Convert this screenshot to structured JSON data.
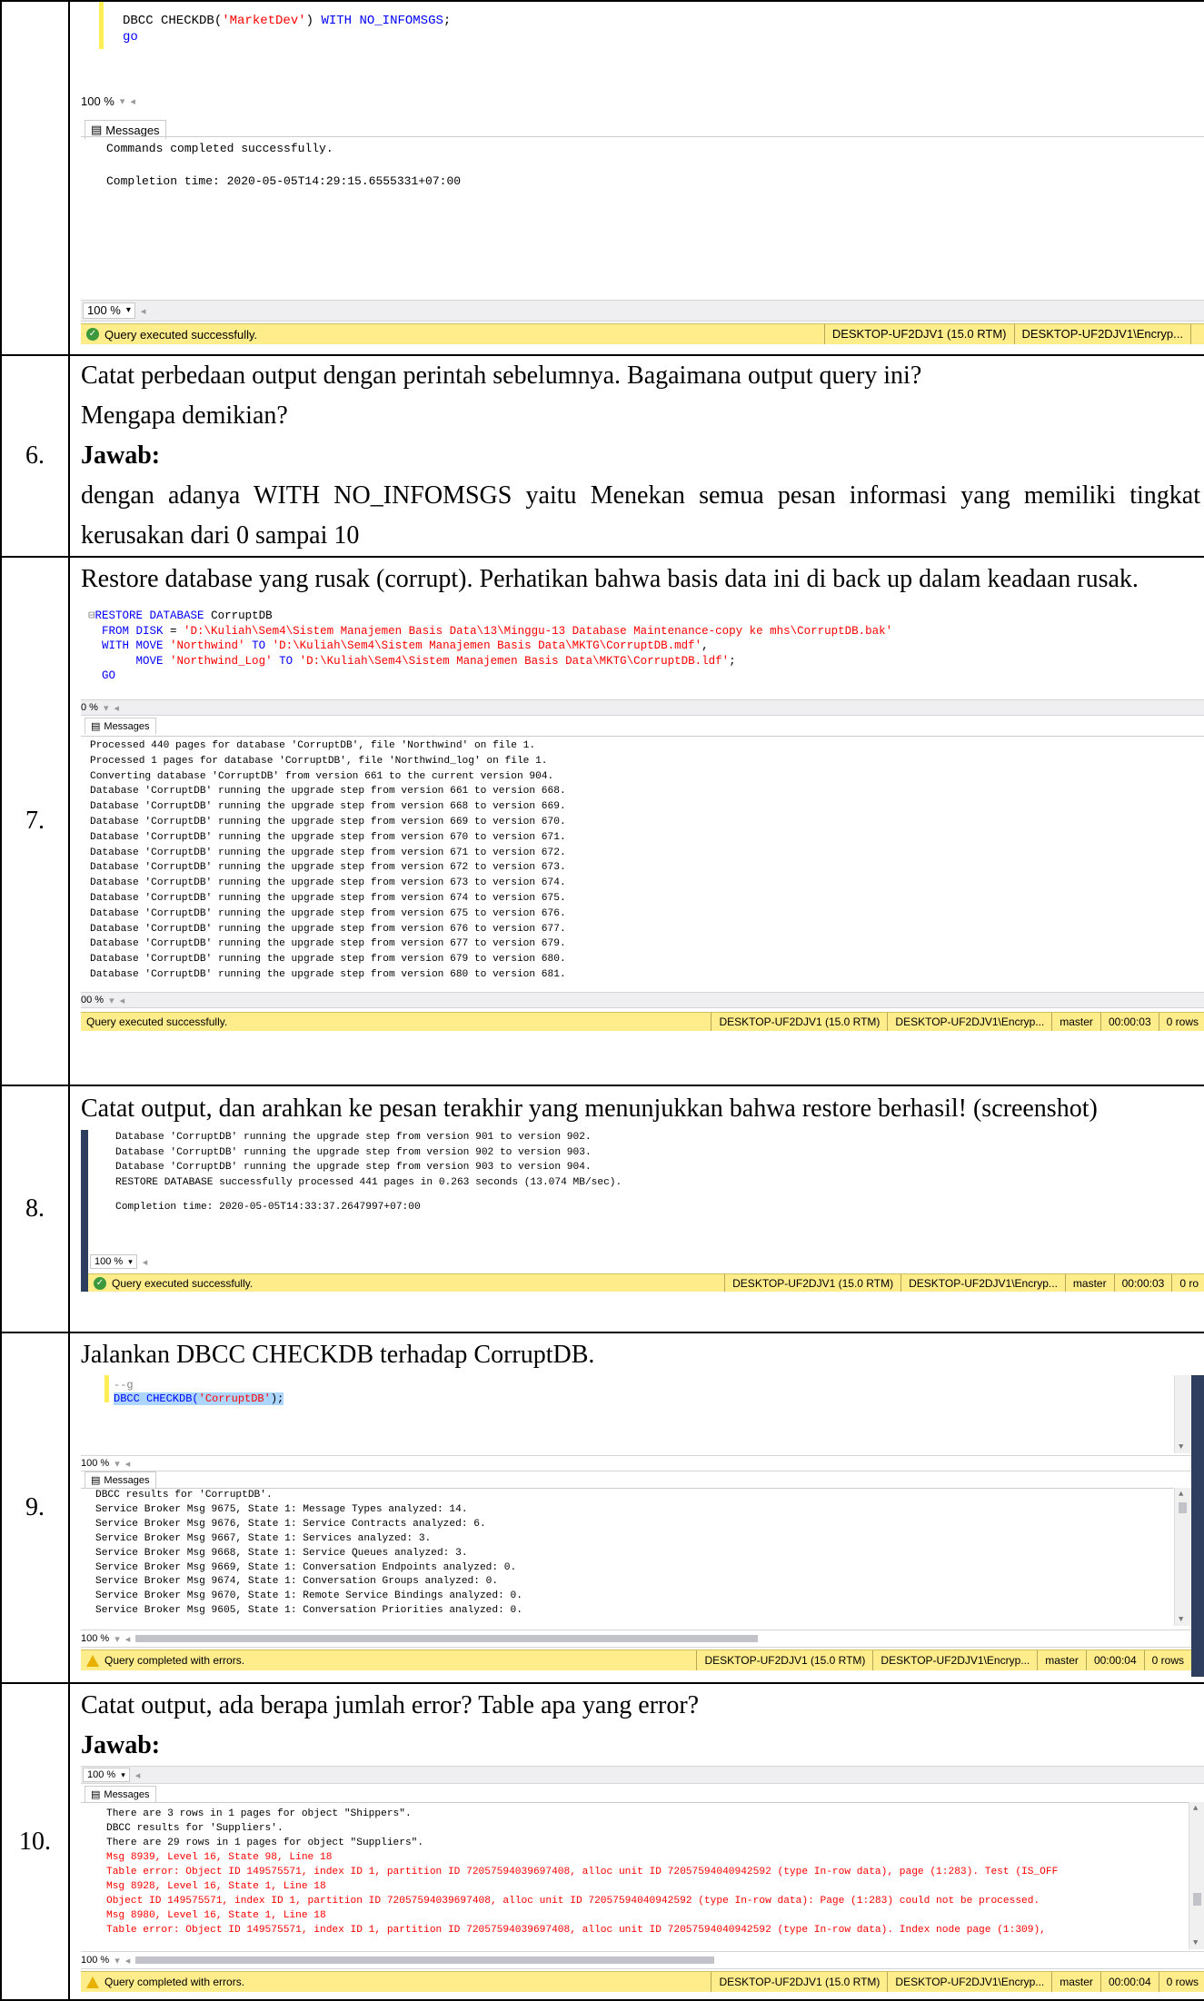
{
  "rows": [
    {
      "number": "",
      "shot1": {
        "code_line1_pre": "DBCC CHECKDB(",
        "code_line1_str": "'MarketDev'",
        "code_line1_mid": ") ",
        "code_line1_kw": "WITH NO_INFOMSGS",
        "code_line1_end": ";",
        "code_line2": "go",
        "zoom": "100 %",
        "messages_tab": "Messages",
        "messages": [
          "Commands completed successfully.",
          "",
          "Completion time: 2020-05-05T14:29:15.6555331+07:00"
        ],
        "status": "Query executed successfully.",
        "server": "DESKTOP-UF2DJV1 (15.0 RTM)",
        "user": "DESKTOP-UF2DJV1\\Encryp..."
      }
    },
    {
      "number": "6.",
      "text1": "Catat perbedaan output dengan perintah sebelumnya. Bagaimana output query ini?",
      "text2": "Mengapa demikian?",
      "answer_label": "Jawab:",
      "answer": "dengan adanya WITH NO_INFOMSGS yaitu Menekan semua pesan informasi yang memiliki tingkat kerusakan dari 0 sampai 10"
    },
    {
      "number": "7.",
      "text": "Restore database yang rusak (corrupt). Perhatikan bahwa basis data ini di back up dalam keadaan rusak.",
      "shot": {
        "l1_kw": "RESTORE DATABASE",
        "l1_rest": " CorruptDB",
        "l2_kw": "FROM DISK",
        "l2_eq": " = ",
        "l2_str": "'D:\\Kuliah\\Sem4\\Sistem Manajemen Basis Data\\13\\Minggu-13 Database Maintenance-copy ke mhs\\CorruptDB.bak'",
        "l3_kw": "WITH MOVE",
        "l3_s1": "'Northwind'",
        "l3_to": " TO ",
        "l3_s2": "'D:\\Kuliah\\Sem4\\Sistem Manajemen Basis Data\\MKTG\\CorruptDB.mdf'",
        "l3_end": ",",
        "l4_kw": "MOVE",
        "l4_s1": "'Northwind_Log'",
        "l4_to": " TO ",
        "l4_s2": "'D:\\Kuliah\\Sem4\\Sistem Manajemen Basis Data\\MKTG\\CorruptDB.ldf'",
        "l4_end": ";",
        "l5": "GO",
        "zoom_top": "0 %",
        "messages_tab": "Messages",
        "messages": [
          "Processed 440 pages for database 'CorruptDB', file 'Northwind' on file 1.",
          "Processed 1 pages for database 'CorruptDB', file 'Northwind_log' on file 1.",
          "Converting database 'CorruptDB' from version 661 to the current version 904.",
          "Database 'CorruptDB' running the upgrade step from version 661 to version 668.",
          "Database 'CorruptDB' running the upgrade step from version 668 to version 669.",
          "Database 'CorruptDB' running the upgrade step from version 669 to version 670.",
          "Database 'CorruptDB' running the upgrade step from version 670 to version 671.",
          "Database 'CorruptDB' running the upgrade step from version 671 to version 672.",
          "Database 'CorruptDB' running the upgrade step from version 672 to version 673.",
          "Database 'CorruptDB' running the upgrade step from version 673 to version 674.",
          "Database 'CorruptDB' running the upgrade step from version 674 to version 675.",
          "Database 'CorruptDB' running the upgrade step from version 675 to version 676.",
          "Database 'CorruptDB' running the upgrade step from version 676 to version 677.",
          "Database 'CorruptDB' running the upgrade step from version 677 to version 679.",
          "Database 'CorruptDB' running the upgrade step from version 679 to version 680.",
          "Database 'CorruptDB' running the upgrade step from version 680 to version 681."
        ],
        "zoom_bottom": "00 %",
        "status": "Query executed successfully.",
        "server": "DESKTOP-UF2DJV1 (15.0 RTM)",
        "user": "DESKTOP-UF2DJV1\\Encryp...",
        "db": "master",
        "time": "00:00:03",
        "rows": "0 rows"
      }
    },
    {
      "number": "8.",
      "text": "Catat output, dan arahkan ke pesan terakhir yang menunjukkan bahwa restore berhasil! (screenshot)",
      "shot": {
        "messages": [
          "Database 'CorruptDB' running the upgrade step from version 901 to version 902.",
          "Database 'CorruptDB' running the upgrade step from version 902 to version 903.",
          "Database 'CorruptDB' running the upgrade step from version 903 to version 904.",
          "RESTORE DATABASE successfully processed 441 pages in 0.263 seconds (13.074 MB/sec).",
          "",
          "Completion time: 2020-05-05T14:33:37.2647997+07:00"
        ],
        "zoom": "100 %",
        "status": "Query executed successfully.",
        "server": "DESKTOP-UF2DJV1 (15.0 RTM)",
        "user": "DESKTOP-UF2DJV1\\Encryp...",
        "db": "master",
        "time": "00:00:03",
        "rows": "0 ro"
      }
    },
    {
      "number": "9.",
      "text": "Jalankan DBCC CHECKDB terhadap CorruptDB.",
      "shot": {
        "code_pre": "DBCC CHECKDB(",
        "code_str": "'CorruptDB'",
        "code_end": ");",
        "zoom": "100 %",
        "messages_tab": "Messages",
        "messages": [
          "DBCC results for 'CorruptDB'.",
          "Service Broker Msg 9675, State 1: Message Types analyzed: 14.",
          "Service Broker Msg 9676, State 1: Service Contracts analyzed: 6.",
          "Service Broker Msg 9667, State 1: Services analyzed: 3.",
          "Service Broker Msg 9668, State 1: Service Queues analyzed: 3.",
          "Service Broker Msg 9669, State 1: Conversation Endpoints analyzed: 0.",
          "Service Broker Msg 9674, State 1: Conversation Groups analyzed: 0.",
          "Service Broker Msg 9670, State 1: Remote Service Bindings analyzed: 0.",
          "Service Broker Msg 9605, State 1: Conversation Priorities analyzed: 0."
        ],
        "zoom_bottom": "100 %",
        "status": "Query completed with errors.",
        "server": "DESKTOP-UF2DJV1 (15.0 RTM)",
        "user": "DESKTOP-UF2DJV1\\Encryp...",
        "db": "master",
        "time": "00:00:04",
        "rows": "0 rows"
      }
    },
    {
      "number": "10.",
      "text": "Catat output, ada berapa jumlah error? Table apa yang error?",
      "answer_label": "Jawab:",
      "shot": {
        "zoom_top": "100 %",
        "messages_tab": "Messages",
        "messages": [
          {
            "t": "There are 3 rows in 1 pages for object \"Shippers\".",
            "red": false
          },
          {
            "t": "DBCC results for 'Suppliers'.",
            "red": false
          },
          {
            "t": "There are 29 rows in 1 pages for object \"Suppliers\".",
            "red": false
          },
          {
            "t": "Msg 8939, Level 16, State 98, Line 18",
            "red": true
          },
          {
            "t": "Table error: Object ID 149575571, index ID 1, partition ID 72057594039697408, alloc unit ID 72057594040942592 (type In-row data), page (1:283). Test (IS_OFF",
            "red": true
          },
          {
            "t": "Msg 8928, Level 16, State 1, Line 18",
            "red": true
          },
          {
            "t": "Object ID 149575571, index ID 1, partition ID 72057594039697408, alloc unit ID 72057594040942592 (type In-row data): Page (1:283) could not be processed.",
            "red": true
          },
          {
            "t": "Msg 8980, Level 16, State 1, Line 18",
            "red": true
          },
          {
            "t": "Table error: Object ID 149575571, index ID 1, partition ID 72057594039697408, alloc unit ID 72057594040942592 (type In-row data). Index node page (1:309),",
            "red": true
          }
        ],
        "zoom_bottom": "100 %",
        "status": "Query completed with errors.",
        "server": "DESKTOP-UF2DJV1 (15.0 RTM)",
        "user": "DESKTOP-UF2DJV1\\Encryp...",
        "db": "master",
        "time": "00:00:04",
        "rows": "0 rows"
      }
    }
  ]
}
